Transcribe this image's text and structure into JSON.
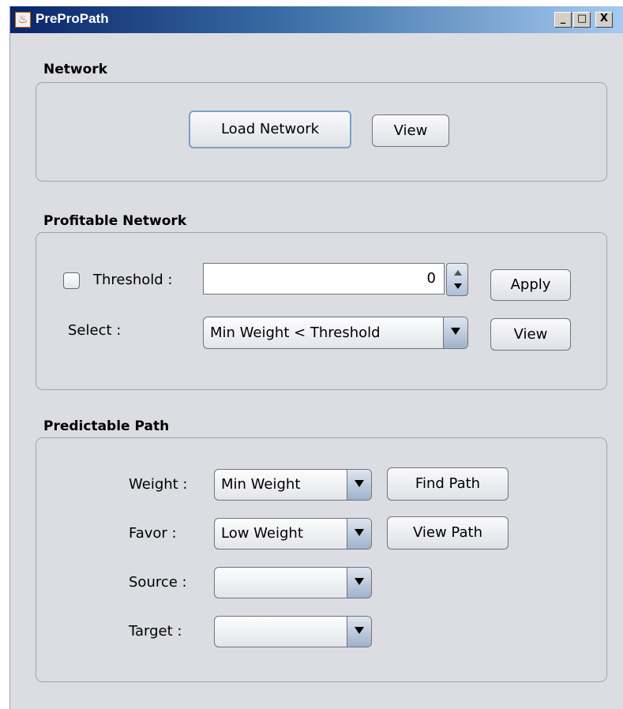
{
  "window": {
    "title": "PreProPath",
    "app_icon": "java-coffee-icon",
    "controls": {
      "minimize": "_",
      "maximize": "□",
      "close": "X"
    }
  },
  "network": {
    "title": "Network",
    "load_label": "Load Network",
    "view_label": "View"
  },
  "profitable": {
    "title": "Profitable Network",
    "threshold_label": "Threshold :",
    "threshold_checked": false,
    "threshold_value": "0",
    "apply_label": "Apply",
    "select_label": "Select :",
    "select_value": "Min Weight < Threshold",
    "view_label": "View"
  },
  "predictable": {
    "title": "Predictable Path",
    "weight_label": "Weight :",
    "weight_value": "Min Weight",
    "find_label": "Find Path",
    "favor_label": "Favor :",
    "favor_value": "Low Weight",
    "view_path_label": "View Path",
    "source_label": "Source :",
    "source_value": "",
    "target_label": "Target :",
    "target_value": ""
  },
  "colors": {
    "window_bg": "#dcdde2",
    "titlebar_start": "#0a246a",
    "titlebar_end": "#a6caf0",
    "focus_border": "#7aa0cc"
  }
}
